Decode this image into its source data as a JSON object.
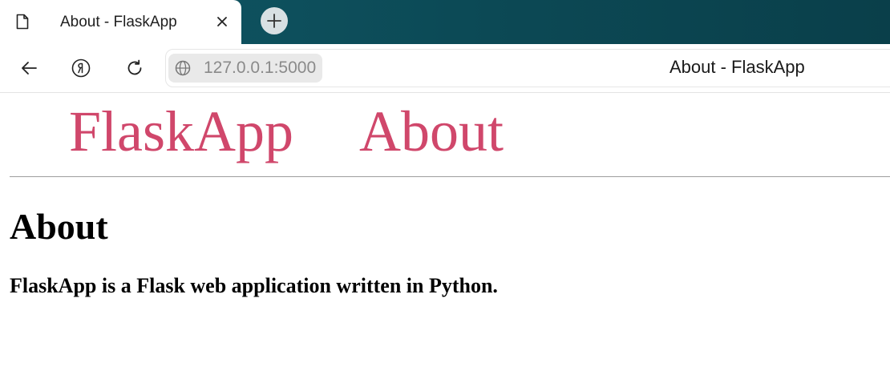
{
  "browser": {
    "tab": {
      "title": "About - FlaskApp",
      "close_icon": "close-icon",
      "page_icon": "page-icon"
    },
    "new_tab_icon": "plus-icon",
    "toolbar": {
      "back_icon": "arrow-left-icon",
      "yandex_icon": "yandex-logo-icon",
      "reload_icon": "reload-icon"
    },
    "address_bar": {
      "url": "127.0.0.1:5000",
      "page_title": "About - FlaskApp",
      "site_icon": "globe-icon"
    }
  },
  "site": {
    "nav": {
      "brand": "FlaskApp",
      "about": "About"
    },
    "heading": "About",
    "paragraph": "FlaskApp is a Flask web application written in Python."
  },
  "colors": {
    "link": "#d0476b",
    "tabbar": "#0c4955"
  }
}
